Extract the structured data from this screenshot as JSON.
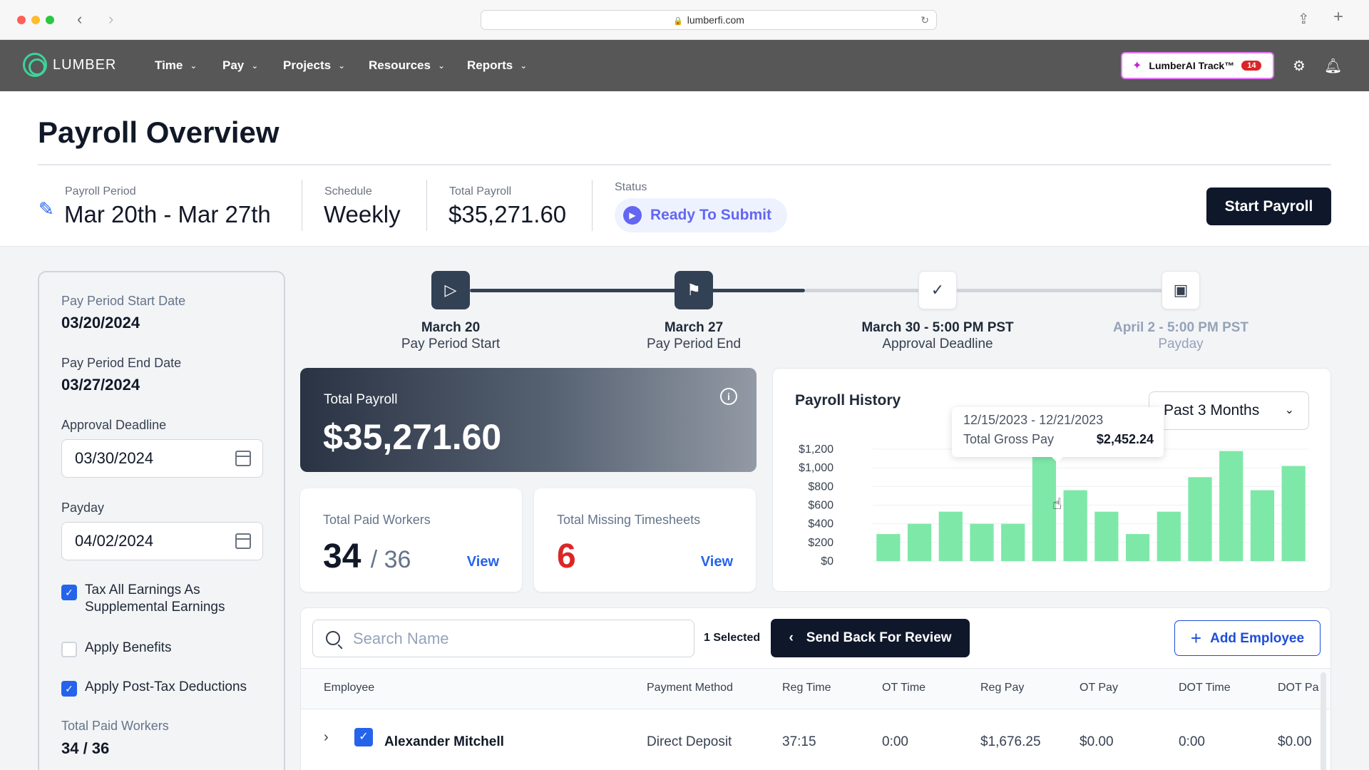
{
  "browser": {
    "url": "lumberfi.com"
  },
  "nav": {
    "brand": "LUMBER",
    "menu": [
      "Time",
      "Pay",
      "Projects",
      "Resources",
      "Reports"
    ],
    "ai_button": "LumberAI Track™",
    "ai_badge": "14"
  },
  "header": {
    "title": "Payroll Overview",
    "period_label": "Payroll Period",
    "period_value": "Mar 20th - Mar 27th",
    "schedule_label": "Schedule",
    "schedule_value": "Weekly",
    "total_label": "Total Payroll",
    "total_value": "$35,271.60",
    "status_label": "Status",
    "status_value": "Ready To Submit",
    "start_button": "Start Payroll"
  },
  "sidebar": {
    "start_label": "Pay Period Start Date",
    "start_value": "03/20/2024",
    "end_label": "Pay Period End Date",
    "end_value": "03/27/2024",
    "approval_label": "Approval Deadline",
    "approval_value": "03/30/2024",
    "payday_label": "Payday",
    "payday_value": "04/02/2024",
    "checkboxes": [
      {
        "label": "Tax All Earnings As Supplemental Earnings",
        "checked": true
      },
      {
        "label": "Apply Benefits",
        "checked": false
      },
      {
        "label": "Apply Post-Tax Deductions",
        "checked": true
      }
    ],
    "paid_label": "Total Paid Workers",
    "paid_value": "34 / 36"
  },
  "timeline": [
    {
      "date": "March 20",
      "label": "Pay Period Start",
      "state": "done"
    },
    {
      "date": "March 27",
      "label": "Pay Period End",
      "state": "done"
    },
    {
      "date": "March 30 - 5:00 PM PST",
      "label": "Approval Deadline",
      "state": "todo"
    },
    {
      "date": "April 2 - 5:00 PM PST",
      "label": "Payday",
      "state": "future"
    }
  ],
  "summary": {
    "total_label": "Total Payroll",
    "total_value": "$35,271.60",
    "paid_label": "Total Paid Workers",
    "paid_count": "34",
    "paid_of": "/ 36",
    "missing_label": "Total Missing Timesheets",
    "missing_count": "6",
    "view": "View"
  },
  "history": {
    "title": "Payroll History",
    "range": "Past 3 Months",
    "tooltip_range": "12/15/2023 - 12/21/2023",
    "tooltip_key": "Total Gross Pay",
    "tooltip_value": "$2,452.24"
  },
  "chart_data": {
    "type": "bar",
    "yticks": [
      "$0",
      "$200",
      "$400",
      "$600",
      "$800",
      "$1,000",
      "$1,200"
    ],
    "ylim": [
      0,
      1200
    ],
    "values": [
      290,
      400,
      530,
      400,
      400,
      1200,
      760,
      530,
      290,
      530,
      900,
      1180,
      760,
      1020
    ],
    "color": "#7ee8a9"
  },
  "table": {
    "search_placeholder": "Search Name",
    "selected": "1 Selected",
    "send_back": "Send Back For Review",
    "add_employee": "Add Employee",
    "columns": [
      "Employee",
      "Payment Method",
      "Reg Time",
      "OT Time",
      "Reg Pay",
      "OT Pay",
      "DOT Time",
      "DOT Pa"
    ],
    "rows": [
      {
        "name": "Alexander Mitchell",
        "method": "Direct Deposit",
        "reg_time": "37:15",
        "ot_time": "0:00",
        "reg_pay": "$1,676.25",
        "ot_pay": "$0.00",
        "dot_time": "0:00",
        "dot_pay": "$0.00"
      }
    ]
  }
}
